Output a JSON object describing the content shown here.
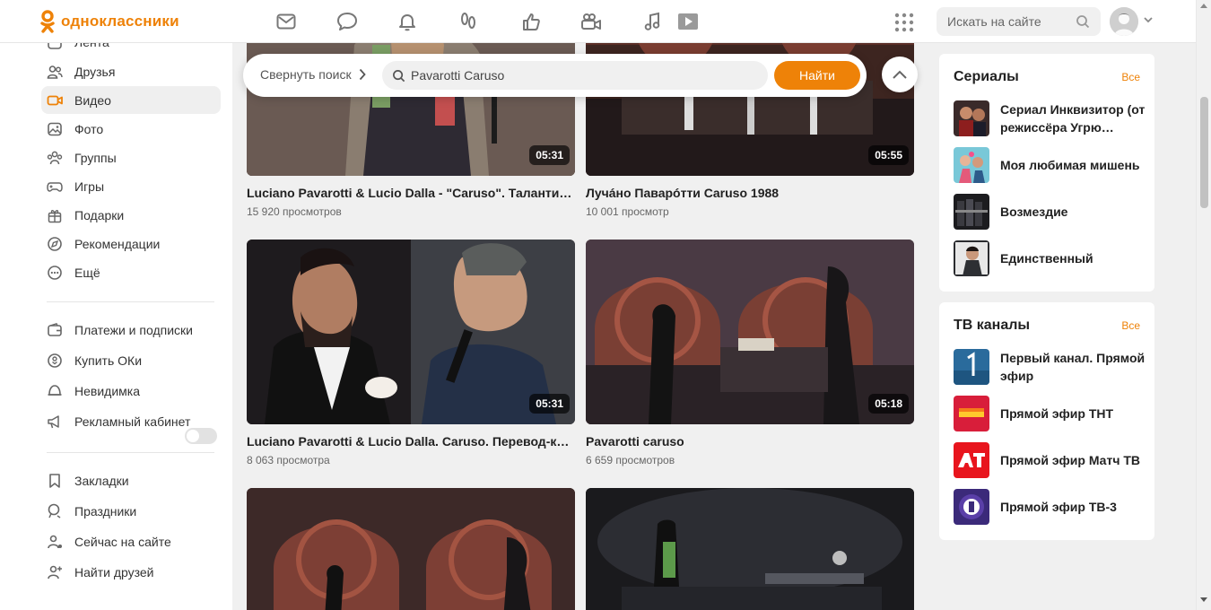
{
  "header": {
    "logo_text": "одноклассники",
    "search_placeholder": "Искать на сайте"
  },
  "sidebar": {
    "items": [
      {
        "label": "Лента",
        "icon": "feed-icon"
      },
      {
        "label": "Друзья",
        "icon": "friends-icon"
      },
      {
        "label": "Видео",
        "icon": "video-icon",
        "active": true
      },
      {
        "label": "Фото",
        "icon": "photo-icon"
      },
      {
        "label": "Группы",
        "icon": "groups-icon"
      },
      {
        "label": "Игры",
        "icon": "games-icon"
      },
      {
        "label": "Подарки",
        "icon": "gift-icon"
      },
      {
        "label": "Рекомендации",
        "icon": "compass-icon"
      },
      {
        "label": "Ещё",
        "icon": "more-icon"
      }
    ],
    "items2": [
      {
        "label": "Платежи и подписки",
        "icon": "wallet-icon"
      },
      {
        "label": "Купить ОКи",
        "icon": "coin-icon"
      },
      {
        "label": "Невидимка",
        "icon": "invisible-icon"
      },
      {
        "label": "Рекламный кабинет",
        "icon": "megaphone-icon"
      }
    ],
    "items3": [
      {
        "label": "Закладки",
        "icon": "bookmark-icon"
      },
      {
        "label": "Праздники",
        "icon": "balloon-icon"
      },
      {
        "label": "Сейчас на сайте",
        "icon": "online-users-icon"
      },
      {
        "label": "Найти друзей",
        "icon": "add-friend-icon"
      }
    ]
  },
  "searchbar": {
    "collapse_label": "Свернуть поиск",
    "query": "Pavarotti Caruso",
    "find_label": "Найти"
  },
  "videos": [
    {
      "title": "Luciano Pavarotti & Lucio Dalla - \"Caruso\". Талантище!!!",
      "views": "15 920 просмотров",
      "duration": "05:31"
    },
    {
      "title": "Лучáно Паварóтти Caruso 1988",
      "views": "10 001 просмотр",
      "duration": "05:55"
    },
    {
      "title": "Luciano Pavarotti & Lucio Dalla. Caruso. Перевод-караоке",
      "views": "8 063 просмотра",
      "duration": "05:31"
    },
    {
      "title": "Pavarotti caruso",
      "views": "6 659 просмотров",
      "duration": "05:18"
    }
  ],
  "serials": {
    "title": "Сериалы",
    "all_label": "Все",
    "items": [
      {
        "label": "Сериал Инквизитор (от режиссёра Угрю…"
      },
      {
        "label": "Моя любимая мишень"
      },
      {
        "label": "Возмездие"
      },
      {
        "label": "Единственный"
      }
    ]
  },
  "tv": {
    "title": "ТВ каналы",
    "all_label": "Все",
    "items": [
      {
        "label": "Первый канал. Прямой эфир"
      },
      {
        "label": "Прямой эфир ТНТ"
      },
      {
        "label": "Прямой эфир Матч ТВ"
      },
      {
        "label": "Прямой эфир ТВ-3"
      }
    ]
  },
  "colors": {
    "brand": "#ee8208",
    "page_bg": "#f0f0f0"
  }
}
